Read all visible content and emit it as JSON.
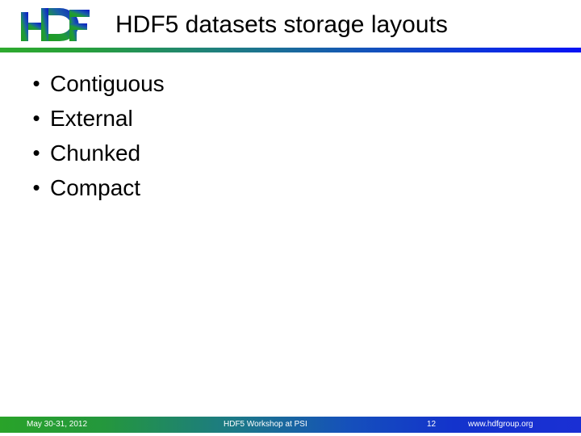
{
  "slide": {
    "title": "HDF5 datasets storage layouts",
    "logo_text": "HDF",
    "bullets": [
      {
        "marker": "•",
        "label": "Contiguous"
      },
      {
        "marker": "•",
        "label": "External"
      },
      {
        "marker": "•",
        "label": "Chunked"
      },
      {
        "marker": "•",
        "label": "Compact"
      }
    ],
    "footer": {
      "date": "May 30-31, 2012",
      "event": "HDF5 Workshop at PSI",
      "page_number": "12",
      "url": "www.hdfgroup.org"
    },
    "colors": {
      "gradient_start": "#2eaa2e",
      "gradient_end": "#0b12f0",
      "title_text": "#000000",
      "footer_text": "#ffffff",
      "background": "#ffffff"
    }
  }
}
